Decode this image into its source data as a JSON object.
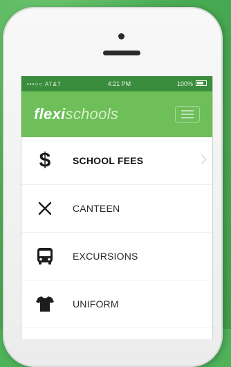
{
  "status_bar": {
    "carrier": "•••○○ AT&T",
    "time": "4:21 PM",
    "battery": "100%"
  },
  "app": {
    "logo_part1": "flexi",
    "logo_part2": "schools"
  },
  "menu": {
    "items": [
      {
        "label": "SCHOOL FEES",
        "icon": "dollar-icon"
      },
      {
        "label": "CANTEEN",
        "icon": "cross-cutlery-icon"
      },
      {
        "label": "EXCURSIONS",
        "icon": "bus-icon"
      },
      {
        "label": "UNIFORM",
        "icon": "shirt-icon"
      }
    ]
  },
  "colors": {
    "background": "#4fb35a",
    "navbar": "#6ebf5a",
    "statusbar": "#3a8d3c"
  }
}
